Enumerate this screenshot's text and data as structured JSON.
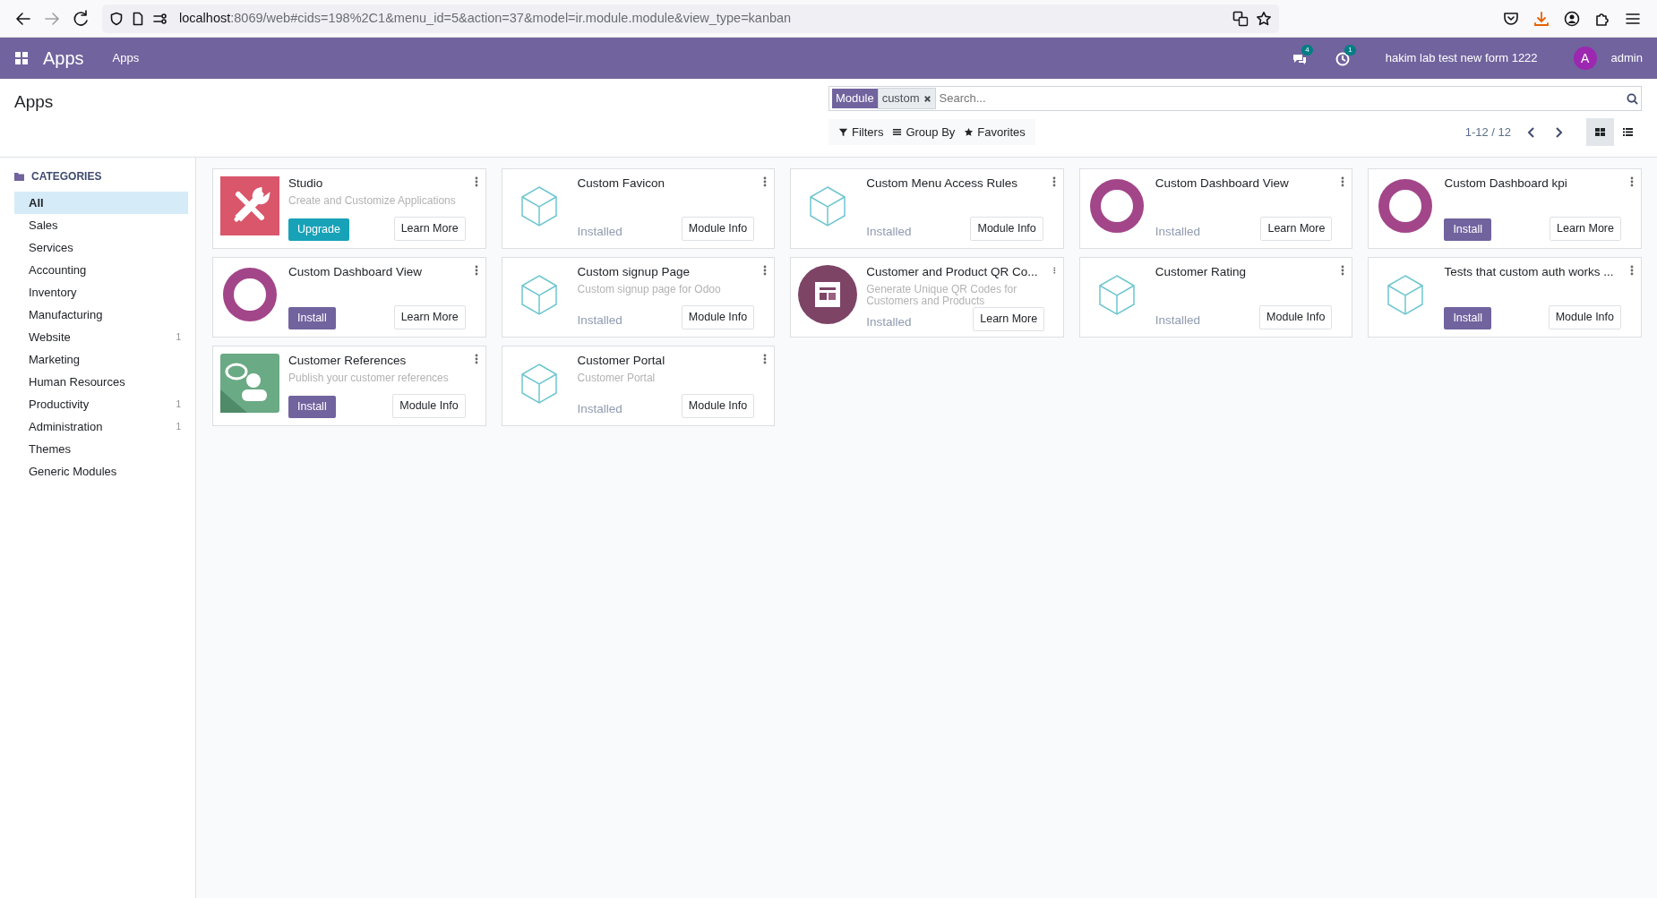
{
  "browser": {
    "url_host": "localhost",
    "url_rest": ":8069/web#cids=198%2C1&menu_id=5&action=37&model=ir.module.module&view_type=kanban"
  },
  "navbar": {
    "app_name": "Apps",
    "menu": [
      "Apps"
    ],
    "messages_count": "4",
    "activities_count": "1",
    "company": "hakim lab test new form 1222",
    "user_initial": "A",
    "user": "admin"
  },
  "control_panel": {
    "title": "Apps",
    "facet": {
      "label": "Module",
      "value": "custom"
    },
    "search": {
      "placeholder": "Search..."
    },
    "search_options": [
      "Filters",
      "Group By",
      "Favorites"
    ],
    "pager": "1-12 / 12",
    "views": [
      {
        "kind": "kanban",
        "selected": true
      },
      {
        "kind": "list",
        "selected": false
      }
    ]
  },
  "sidebar": {
    "heading": "CATEGORIES",
    "items": [
      {
        "label": "All",
        "selected": true
      },
      {
        "label": "Sales",
        "selected": false
      },
      {
        "label": "Services",
        "selected": false
      },
      {
        "label": "Accounting",
        "selected": false
      },
      {
        "label": "Inventory",
        "selected": false
      },
      {
        "label": "Manufacturing",
        "selected": false
      },
      {
        "label": "Website",
        "count": "1",
        "selected": false
      },
      {
        "label": "Marketing",
        "selected": false
      },
      {
        "label": "Human Resources",
        "selected": false
      },
      {
        "label": "Productivity",
        "count": "1",
        "selected": false
      },
      {
        "label": "Administration",
        "count": "1",
        "selected": false
      },
      {
        "label": "Themes",
        "selected": false
      },
      {
        "label": "Generic Modules",
        "selected": false
      }
    ]
  },
  "modules": [
    {
      "name": "Studio",
      "summary": "Create and Customize Applications",
      "kind": "upgrade",
      "action": "Upgrade",
      "secondary": "Learn More"
    },
    {
      "name": "Custom Favicon",
      "kind": "installed",
      "action": "Installed",
      "secondary": "Module Info"
    },
    {
      "name": "Custom Menu Access Rules",
      "kind": "installed",
      "action": "Installed",
      "secondary": "Module Info"
    },
    {
      "name": "Custom Dashboard View",
      "kind": "installed",
      "action": "Installed",
      "secondary": "Learn More"
    },
    {
      "name": "Custom Dashboard kpi",
      "kind": "install",
      "action": "Install",
      "secondary": "Learn More"
    },
    {
      "name": "Custom Dashboard View",
      "kind": "install",
      "action": "Install",
      "secondary": "Learn More"
    },
    {
      "name": "Custom signup Page",
      "summary": "Custom signup page for Odoo",
      "kind": "installed",
      "action": "Installed",
      "secondary": "Module Info"
    },
    {
      "name": "Customer and Product QR Co...",
      "summary": "Generate Unique QR Codes for Customers and Products",
      "kind": "installed",
      "action": "Installed",
      "secondary": "Learn More"
    },
    {
      "name": "Customer Rating",
      "kind": "installed",
      "action": "Installed",
      "secondary": "Module Info"
    },
    {
      "name": "Tests that custom auth works ...",
      "kind": "install",
      "action": "Install",
      "secondary": "Module Info"
    },
    {
      "name": "Customer References",
      "summary": "Publish your customer references",
      "kind": "install",
      "action": "Install",
      "secondary": "Module Info"
    },
    {
      "name": "Customer Portal",
      "summary": "Customer Portal",
      "kind": "installed",
      "action": "Installed",
      "secondary": "Module Info"
    }
  ]
}
